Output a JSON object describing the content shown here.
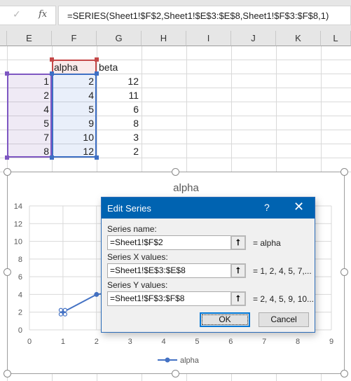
{
  "formula_bar": {
    "check_icon": "✓",
    "fx_label": "fx",
    "formula": "=SERIES(Sheet1!$F$2,Sheet1!$E$3:$E$8,Sheet1!$F$3:$F$8,1)"
  },
  "columns": [
    "E",
    "F",
    "G",
    "H",
    "I",
    "J",
    "K",
    "L"
  ],
  "sheet": {
    "headers": {
      "F": "alpha",
      "G": "beta"
    },
    "rows": [
      {
        "E": "1",
        "F": "2",
        "G": "12"
      },
      {
        "E": "2",
        "F": "4",
        "G": "11"
      },
      {
        "E": "4",
        "F": "5",
        "G": "6"
      },
      {
        "E": "5",
        "F": "9",
        "G": "8"
      },
      {
        "E": "7",
        "F": "10",
        "G": "3"
      },
      {
        "E": "8",
        "F": "12",
        "G": "2"
      }
    ],
    "highlight_colors": {
      "x_range": "#7e57c2",
      "y_range": "#3e6fc4",
      "name": "#c44848"
    }
  },
  "chart_data": {
    "type": "scatter",
    "title": "alpha",
    "series": [
      {
        "name": "alpha",
        "color": "#4472c4",
        "x": [
          1,
          2,
          4,
          5,
          7,
          8
        ],
        "y": [
          2,
          4,
          5,
          9,
          10,
          12
        ]
      }
    ],
    "x_ticks": [
      "0",
      "1",
      "2",
      "3",
      "4",
      "5",
      "6",
      "7",
      "8",
      "9"
    ],
    "y_ticks": [
      "0",
      "2",
      "4",
      "6",
      "8",
      "10",
      "12",
      "14"
    ],
    "xlim": [
      0,
      9
    ],
    "ylim": [
      0,
      14
    ],
    "grid": true,
    "legend": "bottom",
    "selected_point_index": 0
  },
  "dialog": {
    "title": "Edit Series",
    "help": "?",
    "close": "✕",
    "name_label": "Series name:",
    "name_value": "=Sheet1!$F$2",
    "name_result": "= alpha",
    "x_label": "Series X values:",
    "x_value": "=Sheet1!$E$3:$E$8",
    "x_result": "= 1, 2, 4, 5, 7,...",
    "y_label": "Series Y values:",
    "y_value": "=Sheet1!$F$3:$F$8",
    "y_result": "= 2, 4, 5, 9, 10...",
    "collapse_glyph": "⭡",
    "ok": "OK",
    "cancel": "Cancel"
  }
}
